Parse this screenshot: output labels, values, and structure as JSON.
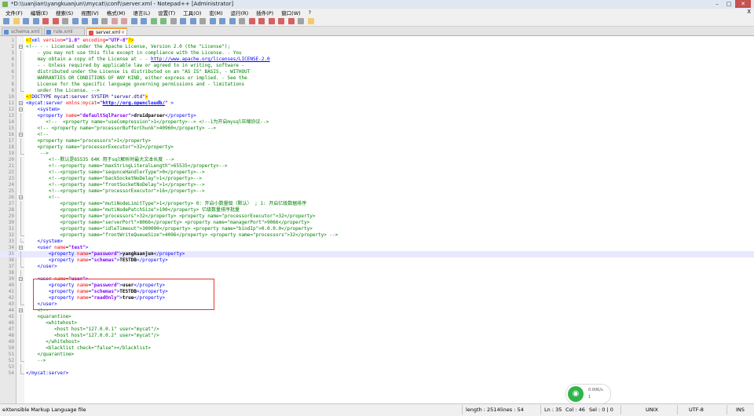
{
  "window": {
    "title": "*D:\\\\uanjian\\\\yangkuanjun\\\\mycat\\\\conf\\\\server.xml - Notepad++ [Administrator]",
    "min": "–",
    "max": "□",
    "close": "✕"
  },
  "menu": [
    "文件(F)",
    "编辑(E)",
    "搜索(S)",
    "视图(V)",
    "格式(M)",
    "语言(L)",
    "设置(T)",
    "工具(O)",
    "宏(M)",
    "运行(R)",
    "插件(P)",
    "窗口(W)",
    "?"
  ],
  "menu_close": "X",
  "tabs": [
    {
      "label": "schema.xml"
    },
    {
      "label": "rule.xml"
    },
    {
      "label": "server.xml"
    }
  ],
  "lines": [
    {
      "n": "1",
      "h": "<span class=\"pi\">&lt;?</span><span class=\"t\">xml</span> <span class=\"a\">version</span>=<span class=\"v\">\"1.0\"</span> <span class=\"a\">encoding</span>=<span class=\"v\">\"UTF-8\"</span><span class=\"pi\">?&gt;</span>"
    },
    {
      "n": "2",
      "h": "<span class=\"c\">&lt;!-- - - Licensed under the Apache License, Version 2.0 (the \"License\");</span>"
    },
    {
      "n": "3",
      "h": "<span class=\"c\">    - you may not use this file except in compliance with the License. - You</span>"
    },
    {
      "n": "4",
      "h": "<span class=\"c\">    may obtain a copy of the License at - - <span class=\"link\">http://www.apache.org/licenses/LICENSE-2.0</span></span>"
    },
    {
      "n": "5",
      "h": "<span class=\"c\">    - - Unless required by applicable law or agreed to in writing, software -</span>"
    },
    {
      "n": "6",
      "h": "<span class=\"c\">    distributed under the License is distributed on an \"AS IS\" BASIS, - WITHOUT</span>"
    },
    {
      "n": "7",
      "h": "<span class=\"c\">    WARRANTIES OR CONDITIONS OF ANY KIND, either express or implied. - See the</span>"
    },
    {
      "n": "8",
      "h": "<span class=\"c\">    License for the specific language governing permissions and - limitations</span>"
    },
    {
      "n": "9",
      "h": "<span class=\"c\">    under the License. --&gt;</span>"
    },
    {
      "n": "10",
      "h": "<span class=\"pi\">&lt;!</span><span class=\"d\">DOCTYPE mycat:server SYSTEM \"server.dtd\"</span><span class=\"pi\">&gt;</span>"
    },
    {
      "n": "11",
      "h": "<span class=\"t\">&lt;mycat:server</span> <span class=\"a\">xmlns:mycat</span>=<span class=\"v\">\"<span class=\"link\">http://org.opencloudb/</span>\"</span> <span class=\"t\">&gt;</span>"
    },
    {
      "n": "12",
      "h": "    <span class=\"t\">&lt;system&gt;</span>"
    },
    {
      "n": "13",
      "h": "    <span class=\"t\">&lt;property</span> <span class=\"a\">name</span>=<span class=\"v\">\"defaultSqlParser\"</span><span class=\"t\">&gt;</span><span class=\"tx2\">druidparser</span><span class=\"t\">&lt;/property&gt;</span>"
    },
    {
      "n": "14",
      "h": "<span class=\"c\">       &lt;!--  &lt;property name=\"useCompression\"&gt;1&lt;/property&gt;--&gt; &lt;!--1为开启mysql压缩协议--&gt;</span>"
    },
    {
      "n": "15",
      "h": "<span class=\"c\">    &lt;!-- &lt;property name=\"processorBufferChunk\"&gt;40960&lt;/property&gt; --&gt;</span>"
    },
    {
      "n": "16",
      "h": "<span class=\"c\">    &lt;!--</span>"
    },
    {
      "n": "17",
      "h": "<span class=\"c\">    &lt;property name=\"processors\"&gt;1&lt;/property&gt;</span>"
    },
    {
      "n": "18",
      "h": "<span class=\"c\">    &lt;property name=\"processorExecutor\"&gt;32&lt;/property&gt;</span>"
    },
    {
      "n": "19",
      "h": "<span class=\"c\">     --&gt;</span>"
    },
    {
      "n": "20",
      "h": "<span class=\"c\">        &lt;!--默认是65535 64K 用于sql解析时最大文本长度 --&gt;</span>"
    },
    {
      "n": "21",
      "h": "<span class=\"c\">        &lt;!--&lt;property name=\"maxStringLiteralLength\"&gt;65535&lt;/property&gt;--&gt;</span>"
    },
    {
      "n": "22",
      "h": "<span class=\"c\">        &lt;!--&lt;property name=\"sequnceHandlerType\"&gt;0&lt;/property&gt;--&gt;</span>"
    },
    {
      "n": "23",
      "h": "<span class=\"c\">        &lt;!--&lt;property name=\"backSocketNoDelay\"&gt;1&lt;/property&gt;--&gt;</span>"
    },
    {
      "n": "24",
      "h": "<span class=\"c\">        &lt;!--&lt;property name=\"frontSocketNoDelay\"&gt;1&lt;/property&gt;--&gt;</span>"
    },
    {
      "n": "25",
      "h": "<span class=\"c\">        &lt;!--&lt;property name=\"processorExecutor\"&gt;16&lt;/property&gt;--&gt;</span>"
    },
    {
      "n": "26",
      "h": "<span class=\"c\">        &lt;!--</span>"
    },
    {
      "n": "27",
      "h": "<span class=\"c\">            &lt;property name=\"mutiNodeLimitType\"&gt;1&lt;/property&gt; 0: 开启小数量级（默认） ; 1: 开启亿级数据排序</span>"
    },
    {
      "n": "28",
      "h": "<span class=\"c\">            &lt;property name=\"mutiNodePatchSize\"&gt;100&lt;/property&gt; 亿级数量排序批量</span>"
    },
    {
      "n": "29",
      "h": "<span class=\"c\">            &lt;property name=\"processors\"&gt;32&lt;/property&gt; &lt;property name=\"processorExecutor\"&gt;32&lt;/property&gt;</span>"
    },
    {
      "n": "30",
      "h": "<span class=\"c\">            &lt;property name=\"serverPort\"&gt;8066&lt;/property&gt; &lt;property name=\"managerPort\"&gt;9066&lt;/property&gt;</span>"
    },
    {
      "n": "31",
      "h": "<span class=\"c\">            &lt;property name=\"idleTimeout\"&gt;300000&lt;/property&gt; &lt;property name=\"bindIp\"&gt;0.0.0.0&lt;/property&gt;</span>"
    },
    {
      "n": "32",
      "h": "<span class=\"c\">            &lt;property name=\"frontWriteQueueSize\"&gt;4096&lt;/property&gt; &lt;property name=\"processors\"&gt;32&lt;/property&gt; --&gt;</span>"
    },
    {
      "n": "33",
      "h": "    <span class=\"t\">&lt;/system&gt;</span>"
    },
    {
      "n": "34",
      "h": "    <span class=\"t\">&lt;user</span> <span class=\"a\">name</span>=<span class=\"v\">\"test\"</span><span class=\"t\">&gt;</span>"
    },
    {
      "n": "35",
      "h": "        <span class=\"t\">&lt;property</span> <span class=\"a\">name</span>=<span class=\"v\">\"password\"</span><span class=\"t\">&gt;</span><span class=\"tx2\">yangkuanjun</span><span class=\"t\">&lt;/property&gt;</span>"
    },
    {
      "n": "36",
      "h": "        <span class=\"t\">&lt;property</span> <span class=\"a\">name</span>=<span class=\"v\">\"schemas\"</span><span class=\"t\">&gt;</span><span class=\"tx2\">TESTDB</span><span class=\"t\">&lt;/property&gt;</span>"
    },
    {
      "n": "37",
      "h": "    <span class=\"t\">&lt;/user&gt;</span>"
    },
    {
      "n": "38",
      "h": ""
    },
    {
      "n": "39",
      "h": "    <span class=\"t\">&lt;user</span> <span class=\"a\">name</span>=<span class=\"v\">\"user\"</span><span class=\"t\">&gt;</span>"
    },
    {
      "n": "40",
      "h": "        <span class=\"t\">&lt;property</span> <span class=\"a\">name</span>=<span class=\"v\">\"password\"</span><span class=\"t\">&gt;</span><span class=\"tx2\">user</span><span class=\"t\">&lt;/property&gt;</span>"
    },
    {
      "n": "41",
      "h": "        <span class=\"t\">&lt;property</span> <span class=\"a\">name</span>=<span class=\"v\">\"schemas\"</span><span class=\"t\">&gt;</span><span class=\"tx2\">TESTDB</span><span class=\"t\">&lt;/property&gt;</span>"
    },
    {
      "n": "42",
      "h": "        <span class=\"t\">&lt;property</span> <span class=\"a\">name</span>=<span class=\"v\">\"readOnly\"</span><span class=\"t\">&gt;</span><span class=\"tx2\">true</span><span class=\"t\">&lt;/property&gt;</span>"
    },
    {
      "n": "43",
      "h": "    <span class=\"t\">&lt;/user&gt;</span>"
    },
    {
      "n": "44",
      "h": "<span class=\"c\">    &lt;!--</span>"
    },
    {
      "n": "45",
      "h": "<span class=\"c\">    &lt;quarantine&gt;</span>"
    },
    {
      "n": "46",
      "h": "<span class=\"c\">       &lt;whitehost&gt;</span>"
    },
    {
      "n": "47",
      "h": "<span class=\"c\">          &lt;host host=\"127.0.0.1\" user=\"mycat\"/&gt;</span>"
    },
    {
      "n": "48",
      "h": "<span class=\"c\">          &lt;host host=\"127.0.0.2\" user=\"mycat\"/&gt;</span>"
    },
    {
      "n": "49",
      "h": "<span class=\"c\">       &lt;/whitehost&gt;</span>"
    },
    {
      "n": "50",
      "h": "<span class=\"c\">       &lt;blacklist check=\"false\"&gt;&lt;/blacklist&gt;</span>"
    },
    {
      "n": "51",
      "h": "<span class=\"c\">    &lt;/quarantine&gt;</span>"
    },
    {
      "n": "52",
      "h": "<span class=\"c\">    --&gt;</span>"
    },
    {
      "n": "53",
      "h": ""
    },
    {
      "n": "54",
      "h": "<span class=\"t\">&lt;/mycat:server&gt;</span>"
    }
  ],
  "current_line": "35",
  "status": {
    "filetype": "eXtensible Markup Language file",
    "length": "length : 2514",
    "lines": "lines : 54",
    "ln": "Ln : 35",
    "col": "Col : 46",
    "sel": "Sel : 0 | 0",
    "eol": "UNIX",
    "enc": "UTF-8",
    "ins": "INS"
  },
  "network": {
    "up": "0.00K/s",
    "down": "1"
  },
  "colors": {
    "tag": "#0000ff",
    "attr": "#ff0000",
    "value": "#8000ff",
    "comment": "#008000",
    "highlight_box": "#ee3333",
    "active_tab_accent": "#f7a13a"
  }
}
